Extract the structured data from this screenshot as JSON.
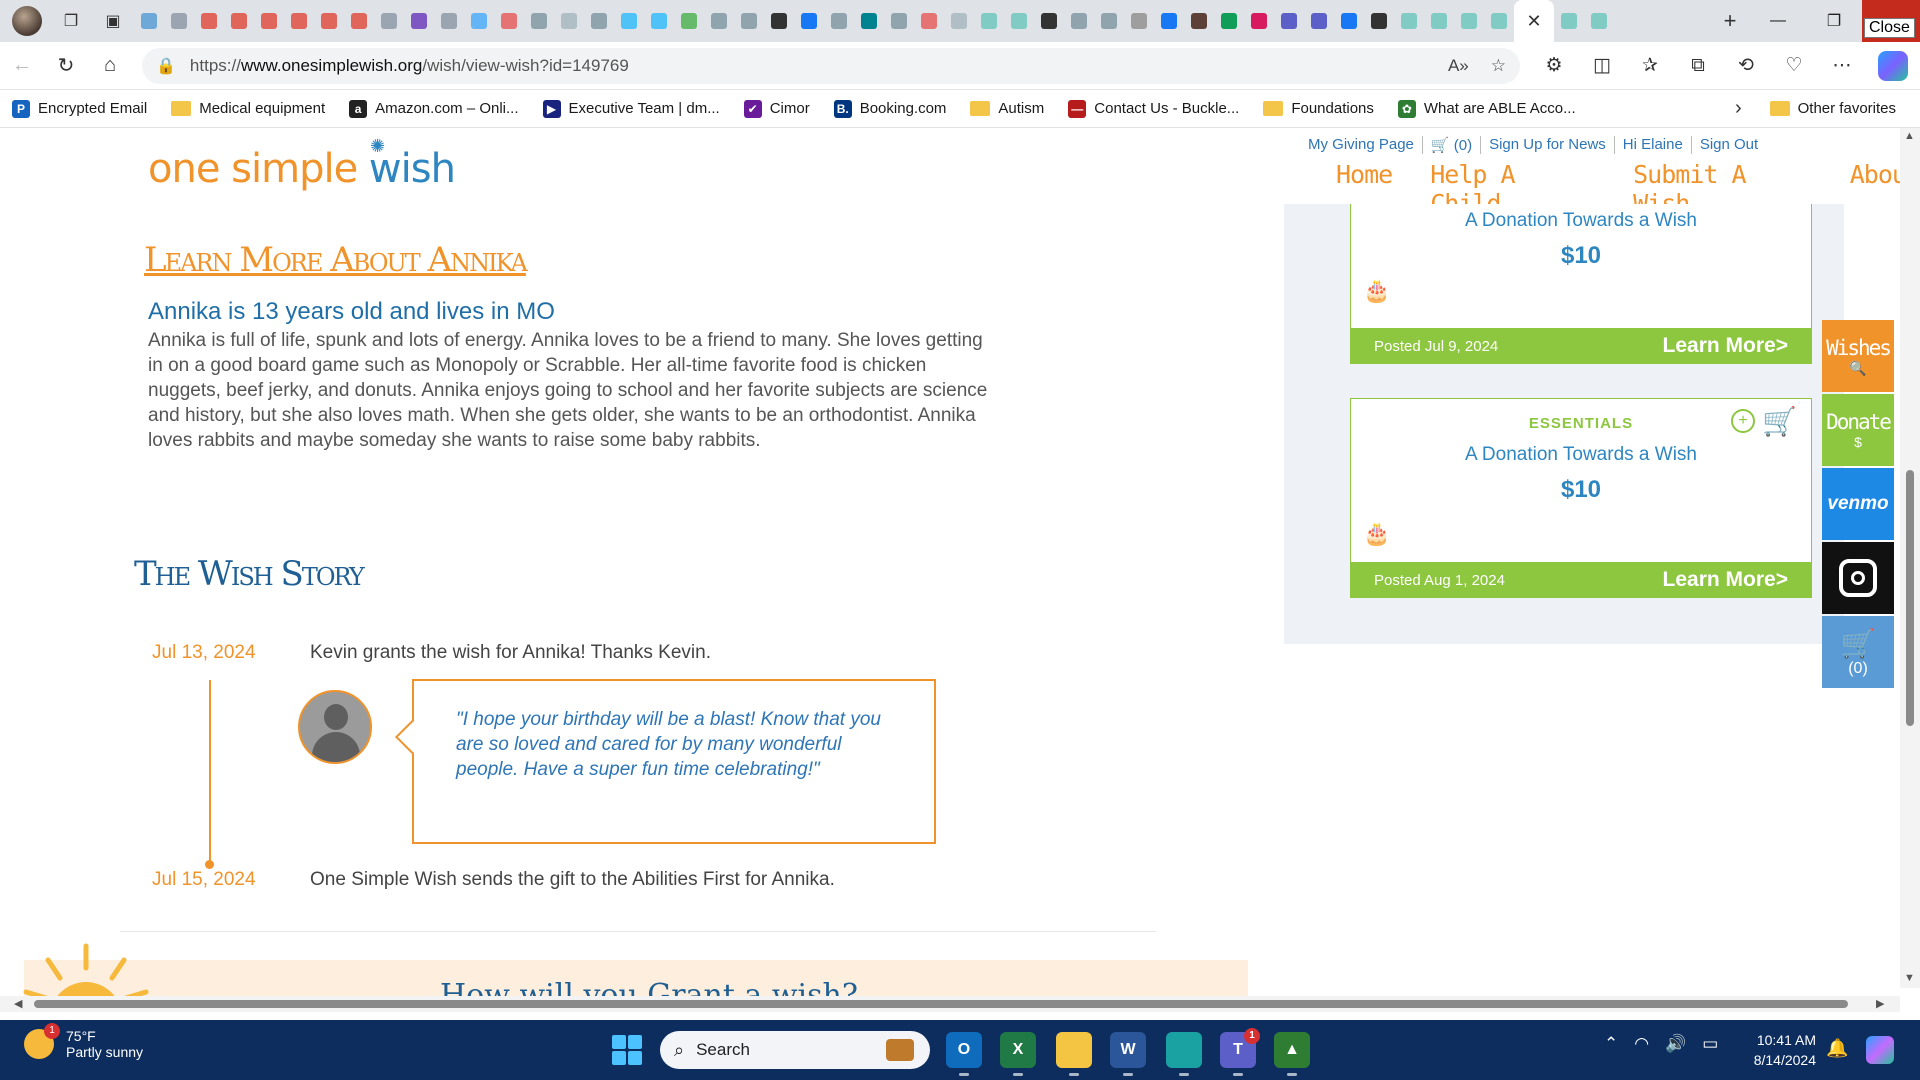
{
  "browser": {
    "close_tooltip": "Close",
    "url_prefix": "https://",
    "url_host": "www.onesimplewish.org",
    "url_path": "/wish/view-wish?id=149769",
    "favorites": [
      {
        "label": "Encrypted Email",
        "icon": "P",
        "color": "#1565c0"
      },
      {
        "label": "Medical equipment",
        "folder": true
      },
      {
        "label": "Amazon.com – Onli...",
        "icon": "a",
        "color": "#222222"
      },
      {
        "label": "Executive Team | dm...",
        "icon": "▶",
        "color": "#1a237e"
      },
      {
        "label": "Cimor",
        "icon": "✔",
        "color": "#6a1b9a"
      },
      {
        "label": "Booking.com",
        "icon": "B.",
        "color": "#003580"
      },
      {
        "label": "Autism",
        "folder": true
      },
      {
        "label": "Contact Us - Buckle...",
        "icon": "—",
        "color": "#b71c1c"
      },
      {
        "label": "Foundations",
        "folder": true
      },
      {
        "label": "What are ABLE Acco...",
        "icon": "✿",
        "color": "#2e7d32"
      }
    ],
    "other_favorites": "Other favorites"
  },
  "site": {
    "logo_one": "one",
    "logo_simple": " simple ",
    "logo_wish": "wish",
    "top_links": [
      "My Giving Page",
      "🛒 (0)",
      "Sign Up for News",
      "Hi Elaine",
      "Sign Out"
    ],
    "nav": [
      "Home",
      "Help A Child",
      "Submit A Wish",
      "About"
    ]
  },
  "wish": {
    "learn_more_heading": "Learn More About Annika",
    "subheading": "Annika is 13 years old and lives in MO",
    "bio": "Annika is full of life, spunk and lots of energy. Annika loves to be a friend to many. She loves getting in on a good board game such as Monopoly or Scrabble. Her all-time favorite food is chicken nuggets, beef jerky, and donuts. Annika enjoys going to school and her favorite subjects are science and history, but she also loves math. When she gets older, she wants to be an orthodontist. Annika loves rabbits and maybe someday she wants to raise some baby rabbits.",
    "story_title": "The Wish Story",
    "timeline": [
      {
        "date": "Jul 13, 2024",
        "text": "Kevin grants the wish for Annika! Thanks Kevin."
      },
      {
        "date": "Jul 15, 2024",
        "text": "One Simple Wish sends the gift to the Abilities First for Annika."
      }
    ],
    "quote": "\"I hope your birthday will be a blast! Know that you are so loved and cared for by many wonderful people. Have a super fun time celebrating!\"",
    "bottom_heading": "How will you Grant a wish?"
  },
  "cards": [
    {
      "category": "",
      "title": "A Donation Towards a Wish",
      "amount": "$10",
      "posted": "Posted Jul 9, 2024",
      "more": "Learn More>"
    },
    {
      "category": "ESSENTIALS",
      "title": "A Donation Towards a Wish",
      "amount": "$10",
      "posted": "Posted Aug 1, 2024",
      "more": "Learn More>"
    }
  ],
  "sidebar_buttons": [
    {
      "label": "Wishes",
      "sub": "🔍",
      "color": "#f0932b"
    },
    {
      "label": "Donate",
      "sub": "$",
      "color": "#8dc63f"
    },
    {
      "label": "venmo",
      "sub": "",
      "color": "#1e88e5"
    },
    {
      "label": "",
      "sub": "",
      "color": "#111111"
    },
    {
      "label": "🛒",
      "sub": "(0)",
      "color": "#5b9bd5"
    }
  ],
  "taskbar": {
    "weather_badge": "1",
    "temp": "75°F",
    "condition": "Partly sunny",
    "search_placeholder": "Search",
    "apps": [
      {
        "name": "outlook",
        "letter": "O",
        "color": "#0f6cbd"
      },
      {
        "name": "excel",
        "letter": "X",
        "color": "#1f7a45"
      },
      {
        "name": "file-explorer",
        "letter": "",
        "color": "#f4c542"
      },
      {
        "name": "word",
        "letter": "W",
        "color": "#2b579a"
      },
      {
        "name": "edge",
        "letter": "",
        "color": "#1aa1a1"
      },
      {
        "name": "teams",
        "letter": "T",
        "color": "#5b5fc7",
        "badge": "1"
      },
      {
        "name": "google-drive",
        "letter": "▲",
        "color": "#2e7d32"
      }
    ],
    "time": "10:41 AM",
    "date": "8/14/2024"
  }
}
